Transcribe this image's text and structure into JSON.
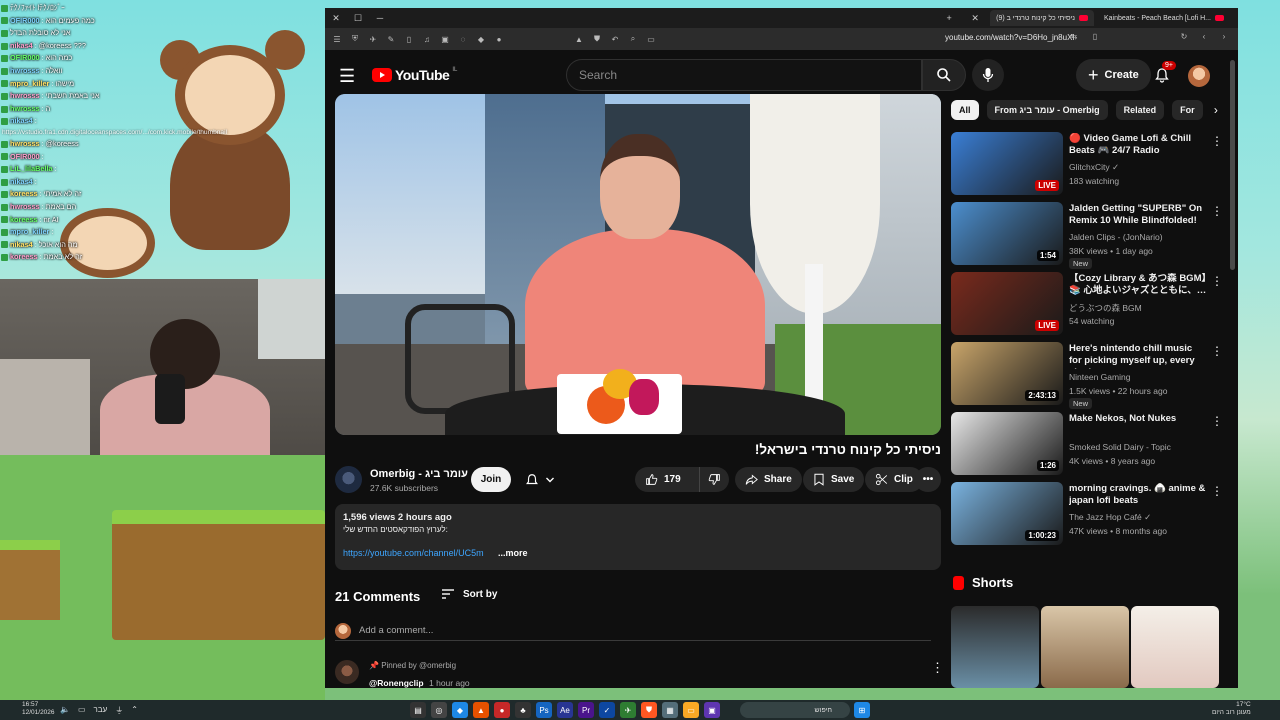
{
  "stream": {
    "chat": [
      {
        "user": "",
        "text": "ﾃｸﾉﾌｧｲﾄ lﾃｸﾉﾛｼﾞｰ"
      },
      {
        "user": "OFIR000",
        "text": "כמה פעמים הוא"
      },
      {
        "user": "",
        "text": "אני לא סובלת הבדל"
      },
      {
        "user": "nikas4",
        "text": "@koreess ???"
      },
      {
        "user": "OFIR000",
        "text": "כמה הוא"
      },
      {
        "user": "hwrosss",
        "text": "וואלה"
      },
      {
        "user": "mpro_killer",
        "text": "מישהו"
      },
      {
        "user": "hwrosss",
        "text": "אני באמת חשבתי"
      },
      {
        "user": "hwrosss",
        "text": "ה"
      },
      {
        "user": "nikas4",
        "text": ""
      },
      {
        "user": "hwrosss",
        "text": "@koreess"
      },
      {
        "user": "OFIR000",
        "text": ""
      },
      {
        "user": "LiL_lilaBella",
        "text": ""
      },
      {
        "user": "nikas4",
        "text": ""
      },
      {
        "user": "koreess",
        "text": "זה לא אמיתי"
      },
      {
        "user": "hwrosss",
        "text": "הם באמת"
      },
      {
        "user": "koreess",
        "text": "nr AI"
      },
      {
        "user": "mpro_killer",
        "text": ""
      },
      {
        "user": "nikas4",
        "text": "מה הוא אוכל"
      },
      {
        "user": "koreess",
        "text": "זה לא באמת"
      }
    ],
    "chat_url": "https://vstudio.fra1.cdn.digitaloceanspaces.com/.../com.kick.mobile/thumbnail"
  },
  "browser": {
    "tabs": [
      {
        "label": "ניסיתי כל קינוח טרנדי ב (9)",
        "active": true
      },
      {
        "label": "Kainbeats - Peach Beach [Lofi H...",
        "active": false
      }
    ],
    "url": "youtube.com/watch?v=D6Ho_jn8uXI"
  },
  "youtube": {
    "logo_text": "YouTube",
    "logo_suffix": "IL",
    "search_placeholder": "Search",
    "create_label": "Create",
    "notif_count": "9+",
    "video": {
      "title": "ניסיתי כל קינוח טרנדי בישראל!",
      "channel": "Omerbig - עומר ביג",
      "subscribers": "27.6K subscribers",
      "join_label": "Join",
      "likes": "179",
      "share_label": "Share",
      "save_label": "Save",
      "clip_label": "Clip",
      "views_time": "1,596 views  2 hours ago",
      "desc_line": "לערוץ הפודקאסטים החדש שלי:",
      "desc_link": "https://youtube.com/channel/UC5m",
      "more_label": "...more"
    },
    "comments": {
      "count_label": "21 Comments",
      "sort_label": "Sort by",
      "add_placeholder": "Add a comment...",
      "pinned_label": "Pinned by @omerbig",
      "pinned_user": "@Ronengclip",
      "pinned_time": "1 hour ago"
    },
    "chips": [
      {
        "label": "All",
        "active": true
      },
      {
        "label": "From עומר ביג - Omerbig",
        "active": false
      },
      {
        "label": "Related",
        "active": false
      },
      {
        "label": "For",
        "active": false
      }
    ],
    "recommendations": [
      {
        "title": "🔴 Video Game Lofi & Chill Beats 🎮 24/7 Radio",
        "channel": "GlitchxCity ✓",
        "meta": "183 watching",
        "badge": "LIVE",
        "new": false,
        "thumb_color": "#3a7fd6"
      },
      {
        "title": "Jalden Getting \"SUPERB\" On Remix 10 While Blindfolded!",
        "channel": "Jalden Clips - (JonNario)",
        "meta": "38K views • 1 day ago",
        "badge": "1:54",
        "new": true,
        "thumb_color": "#4c8fcf"
      },
      {
        "title": "【Cozy Library & あつ森 BGM】📚 心地よいジャズとともに、…",
        "channel": "どうぶつの森 BGM",
        "meta": "54 watching",
        "badge": "LIVE",
        "new": false,
        "thumb_color": "#7a2a1c"
      },
      {
        "title": "Here's nintendo chill music for picking myself up, every single...",
        "channel": "Ninteen Gaming",
        "meta": "1.5K views • 22 hours ago",
        "badge": "2:43:13",
        "new": true,
        "thumb_color": "#c9a56a"
      },
      {
        "title": "Make Nekos, Not Nukes",
        "channel": "Smoked Solid Dairy - Topic",
        "meta": "4K views • 8 years ago",
        "badge": "1:26",
        "new": false,
        "thumb_color": "#e8e8e8"
      },
      {
        "title": "morning cravings. 🍙 anime & japan lofi beats",
        "channel": "The Jazz Hop Café ✓",
        "meta": "47K views • 8 months ago",
        "badge": "1:00:23",
        "new": false,
        "thumb_color": "#7ab3e0"
      }
    ],
    "shorts_label": "Shorts"
  },
  "taskbar": {
    "time": "16:57",
    "date": "12/01/2026",
    "lang": "עבר",
    "search_label": "חיפוש",
    "temp": "17°C",
    "weather": "מעונן רוב היום"
  },
  "colors": {
    "youtube_red": "#ff0000",
    "link_blue": "#3ea6ff",
    "live_red": "#cc0000"
  }
}
